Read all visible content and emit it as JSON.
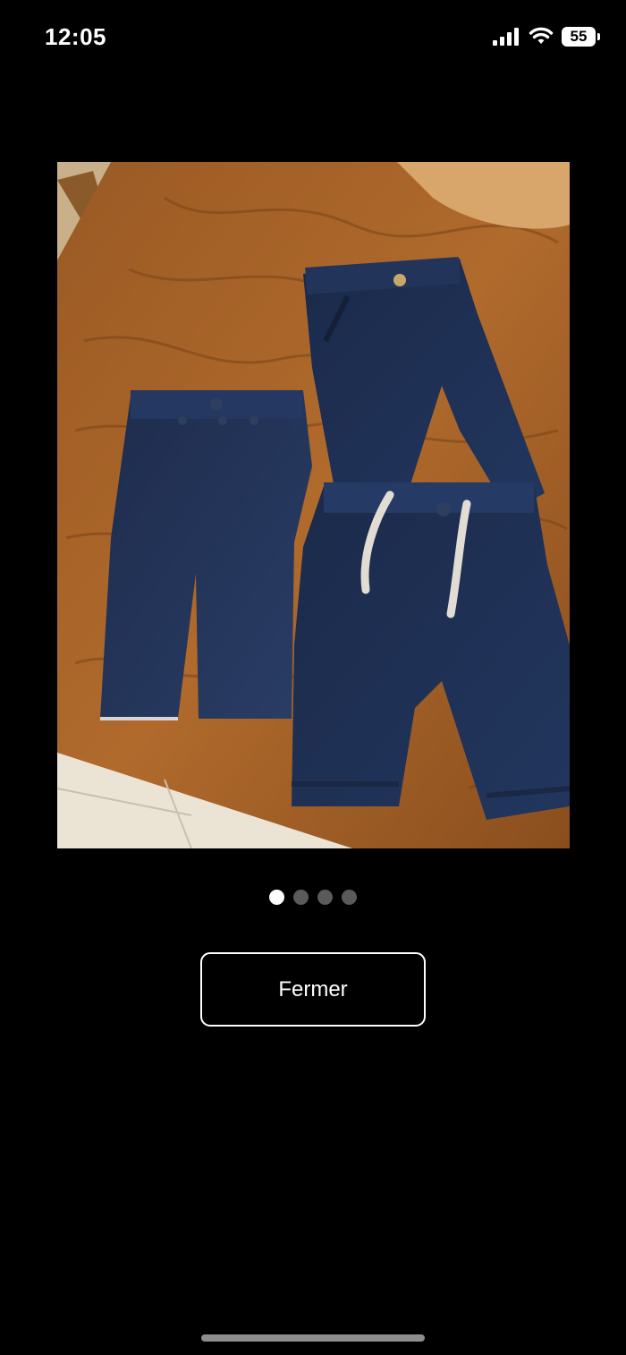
{
  "status_bar": {
    "time": "12:05",
    "battery_level": "55",
    "signal_icon": "cellular-signal-icon",
    "wifi_icon": "wifi-icon",
    "battery_icon": "battery-icon"
  },
  "viewer": {
    "photo_description_icon": "product-photo",
    "pager": {
      "total": 4,
      "active_index": 0
    },
    "close_label": "Fermer"
  },
  "colors": {
    "background": "#000000",
    "button_border": "#ffffff",
    "dot_active": "#ffffff",
    "dot_inactive": "#5a5a5a"
  }
}
